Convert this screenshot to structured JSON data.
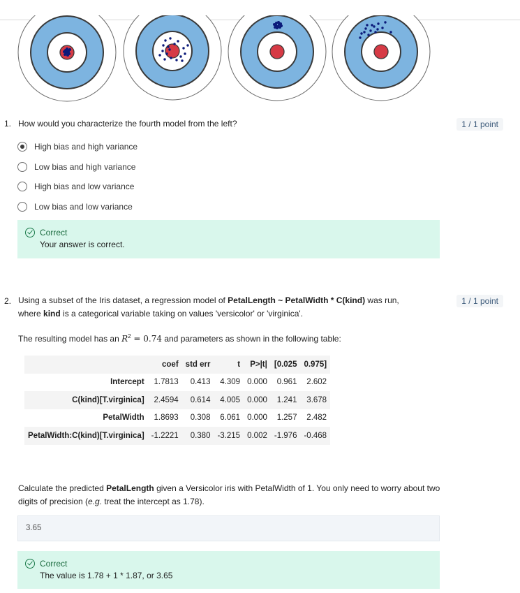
{
  "question1": {
    "number": "1.",
    "prompt": "How would you characterize the fourth model from the left?",
    "points": "1 / 1 point",
    "options": [
      {
        "label": "High bias and high variance",
        "selected": true
      },
      {
        "label": "Low bias and high variance",
        "selected": false
      },
      {
        "label": "High bias and low variance",
        "selected": false
      },
      {
        "label": "Low bias and low variance",
        "selected": false
      }
    ],
    "feedback": {
      "title": "Correct",
      "message": "Your answer is correct."
    }
  },
  "question2": {
    "number": "2.",
    "points": "1 / 1 point",
    "intro_1": "Using a subset of the Iris dataset, a regression model of ",
    "intro_bold_1": "PetalLength ~ PetalWidth * C(kind)",
    "intro_2": " was run,",
    "intro_3": "where ",
    "intro_bold_2": "kind",
    "intro_4": " is a categorical variable taking on values 'versicolor' or 'virginica'.",
    "result_1": "The resulting model has an ",
    "result_r2_symbol": "R",
    "result_r2_exp": "2",
    "result_r2_value": " = 0.74",
    "result_2": " and parameters as shown in the following table:",
    "table": {
      "headers": [
        "",
        "coef",
        "std err",
        "t",
        "P>|t|",
        "[0.025",
        "0.975]"
      ],
      "rows": [
        [
          "Intercept",
          "1.7813",
          "0.413",
          "4.309",
          "0.000",
          "0.961",
          "2.602"
        ],
        [
          "C(kind)[T.virginica]",
          "2.4594",
          "0.614",
          "4.005",
          "0.000",
          "1.241",
          "3.678"
        ],
        [
          "PetalWidth",
          "1.8693",
          "0.308",
          "6.061",
          "0.000",
          "1.257",
          "2.482"
        ],
        [
          "PetalWidth:C(kind)[T.virginica]",
          "-1.2221",
          "0.380",
          "-3.215",
          "0.002",
          "-1.976",
          "-0.468"
        ]
      ]
    },
    "calc_1": "Calculate the predicted ",
    "calc_bold": "PetalLength",
    "calc_2": " given a Versicolor iris with PetalWidth of 1. You only need to worry about two",
    "calc_3": "digits of precision (",
    "calc_eg": "e.g.",
    "calc_4": " treat the intercept as 1.78).",
    "answer_value": "3.65",
    "feedback": {
      "title": "Correct",
      "message": "The value is 1.78 + 1 * 1.87, or 3.65"
    }
  },
  "colors": {
    "ring_blue": "#7db4e0",
    "bullseye_red": "#d63a45",
    "dot_navy": "#0b1a7a",
    "feedback_bg": "#d9f7ec",
    "correct_green": "#1b6b3f"
  }
}
